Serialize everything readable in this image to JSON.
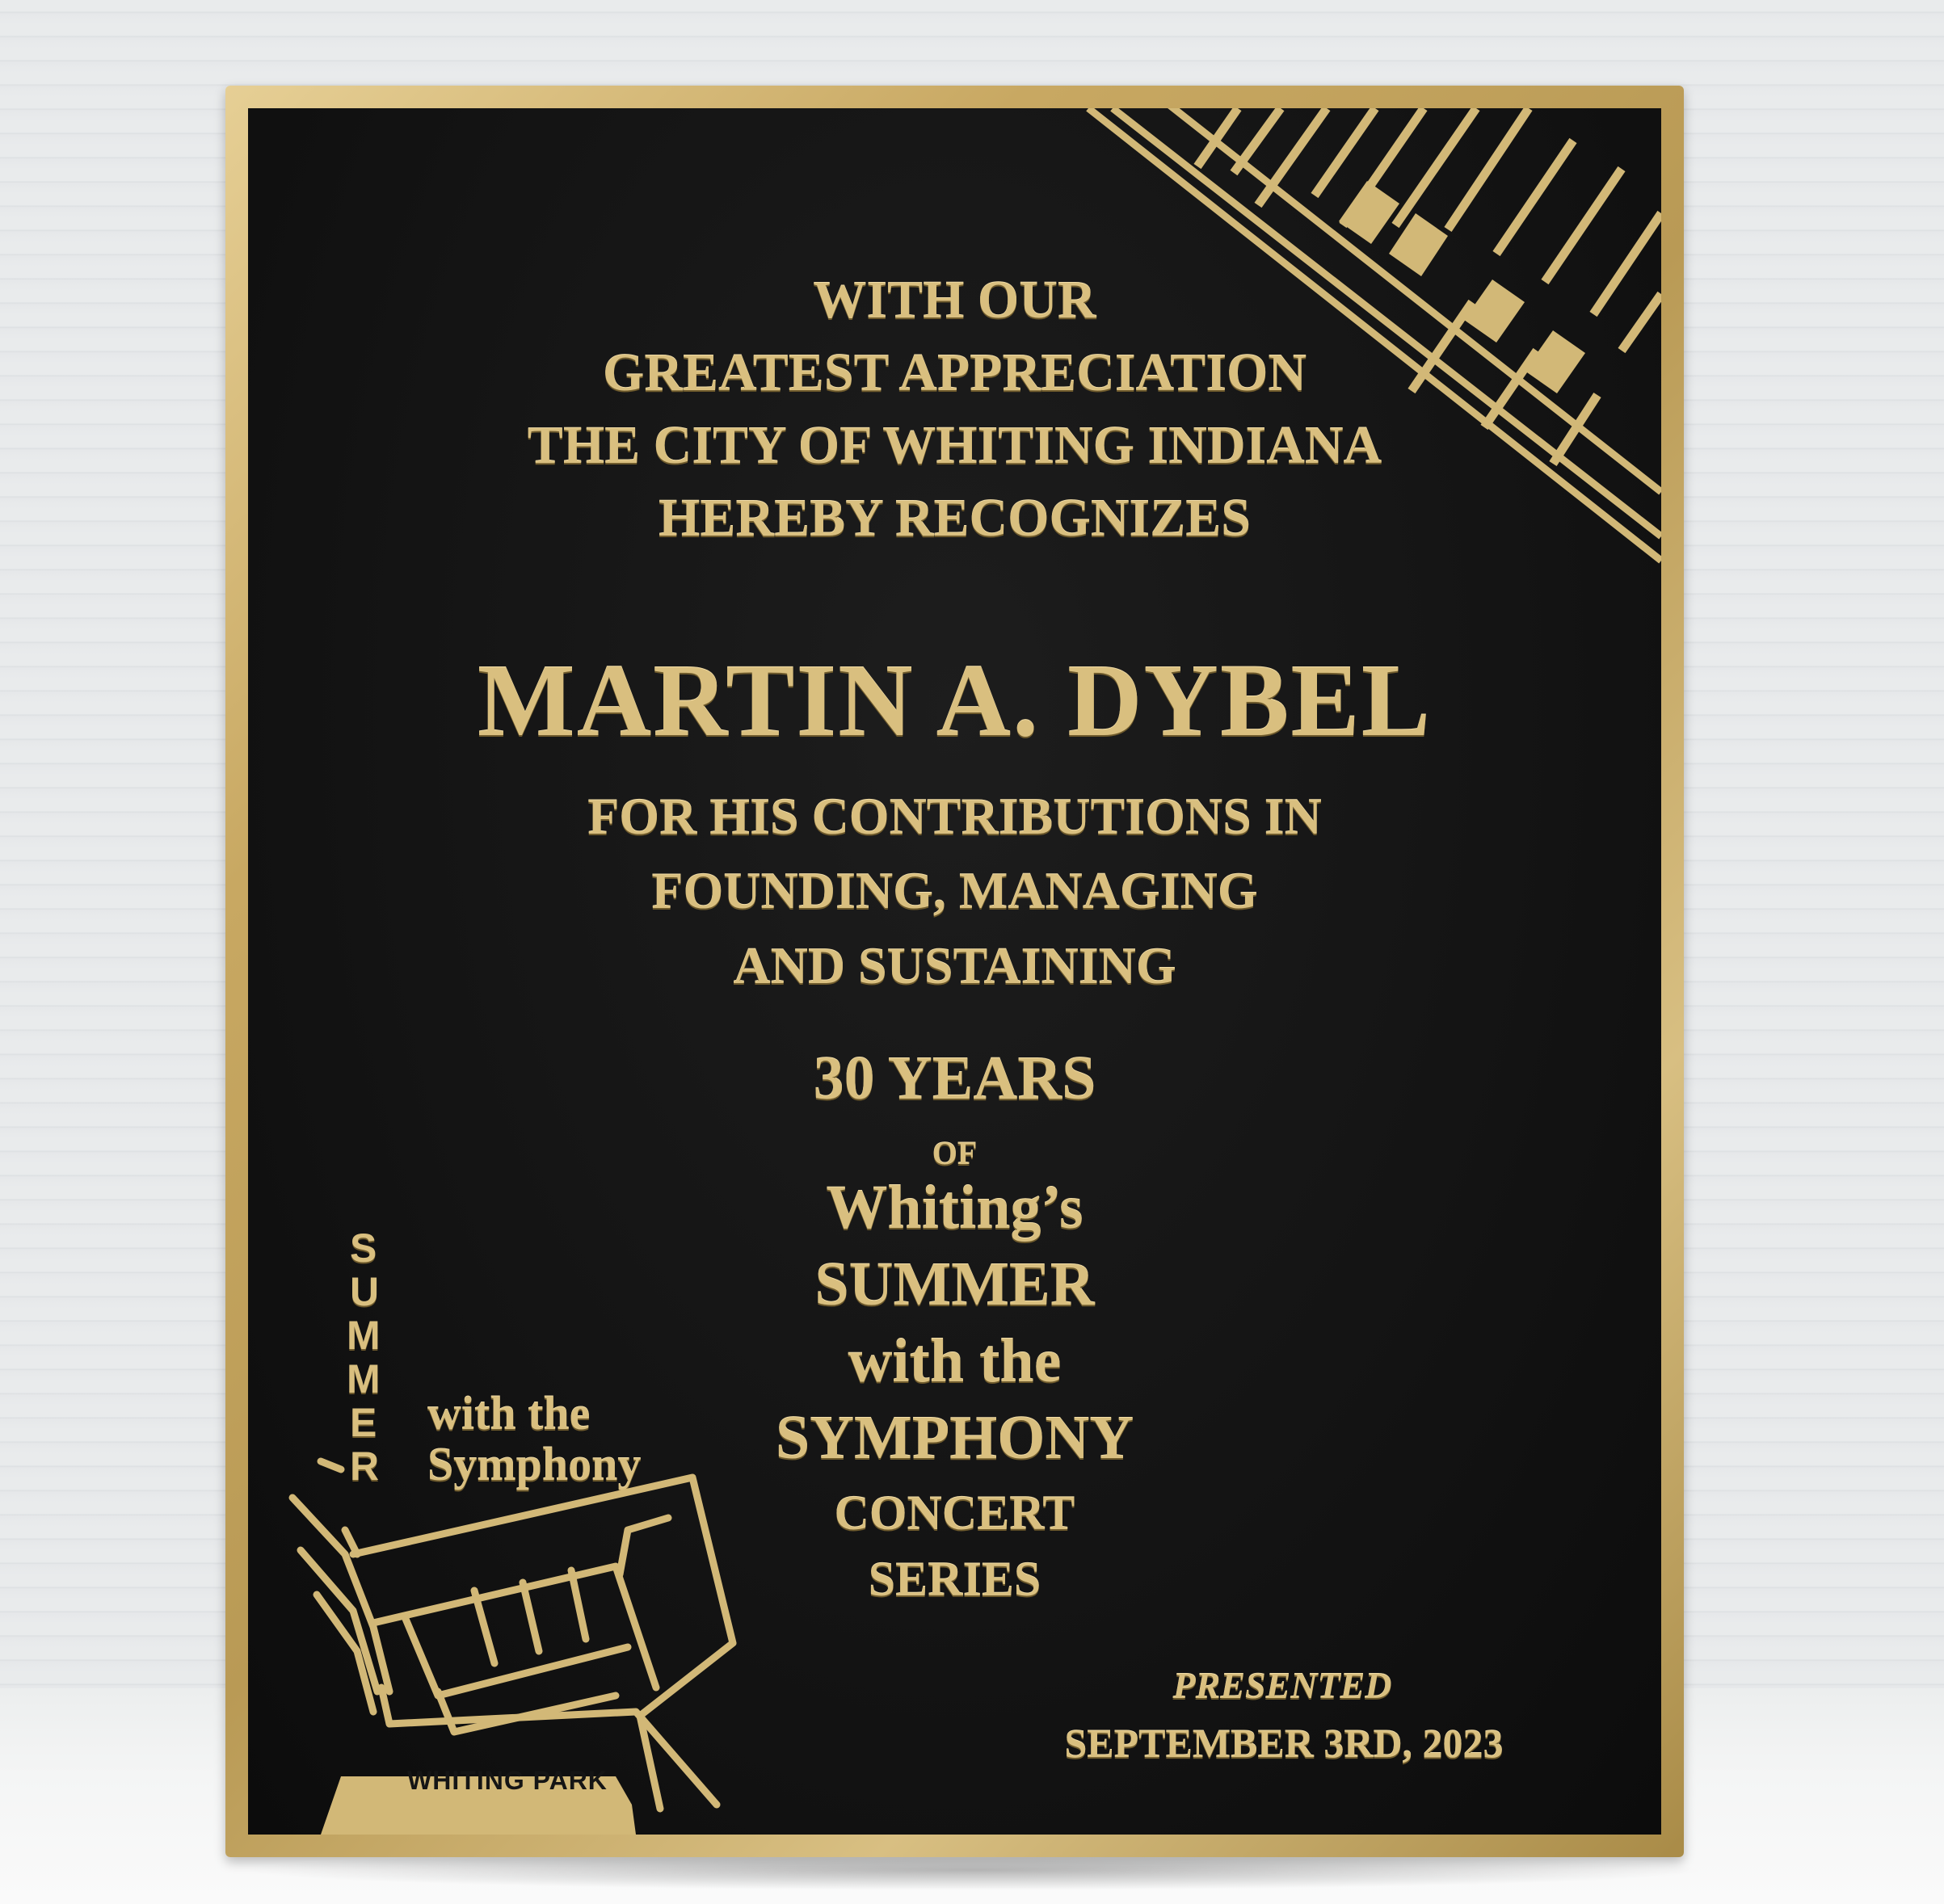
{
  "plaque": {
    "heading": [
      "WITH OUR",
      "GREATEST APPRECIATION",
      "THE CITY OF WHITING INDIANA",
      "HEREBY RECOGNIZES"
    ],
    "honoree": "MARTIN A. DYBEL",
    "reason": [
      "FOR HIS CONTRIBUTIONS IN",
      "FOUNDING, MANAGING",
      "AND SUSTAINING"
    ],
    "years": "30 YEARS",
    "of": "OF",
    "series": {
      "line1": "Whiting’s",
      "line2": "SUMMER",
      "line3": "with the",
      "line4": "SYMPHONY",
      "line5": "CONCERT",
      "line6": "SERIES"
    },
    "presented_label": "PRESENTED",
    "presented_date": "SEPTEMBER 3RD, 2023"
  },
  "logo": {
    "vertical_word": [
      "S",
      "U",
      "M",
      "M",
      "E",
      "R"
    ],
    "line1": "with the",
    "line2": "Symphony",
    "park": "WHITING PARK"
  },
  "colors": {
    "gold": "#d9bf7f",
    "plaque_black": "#141414",
    "brass_border": "#c8a862"
  }
}
